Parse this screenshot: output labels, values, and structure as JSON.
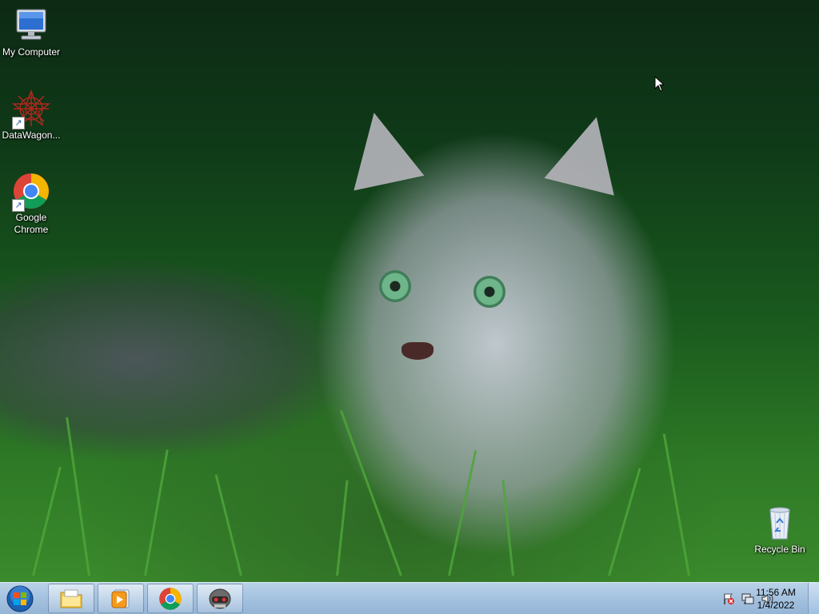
{
  "desktop": {
    "icons": [
      {
        "label": "My Computer",
        "icon": "my-computer-icon"
      },
      {
        "label": "DataWagon...",
        "icon": "datawagon-icon",
        "shortcut": true
      },
      {
        "label": "Google Chrome",
        "icon": "chrome-icon",
        "shortcut": true
      },
      {
        "label": "Recycle Bin",
        "icon": "recycle-bin-icon"
      }
    ]
  },
  "taskbar": {
    "start": {
      "icon": "windows-orb-icon"
    },
    "pinned": [
      {
        "name": "windows-explorer",
        "icon": "folder-icon"
      },
      {
        "name": "media-player",
        "icon": "media-player-icon"
      },
      {
        "name": "google-chrome",
        "icon": "chrome-icon"
      },
      {
        "name": "app-helmet",
        "icon": "helmet-app-icon"
      }
    ],
    "tray": [
      {
        "name": "action-center",
        "icon": "action-center-flag-icon"
      },
      {
        "name": "network",
        "icon": "network-icon"
      },
      {
        "name": "volume",
        "icon": "speaker-icon"
      }
    ],
    "clock": {
      "time": "11:56 AM",
      "date": "1/4/2022"
    }
  },
  "colors": {
    "taskbar": "#a6c3e0",
    "chrome_red": "#db4437",
    "chrome_yellow": "#f4b400",
    "chrome_green": "#0f9d58",
    "chrome_blue": "#4285f4"
  }
}
